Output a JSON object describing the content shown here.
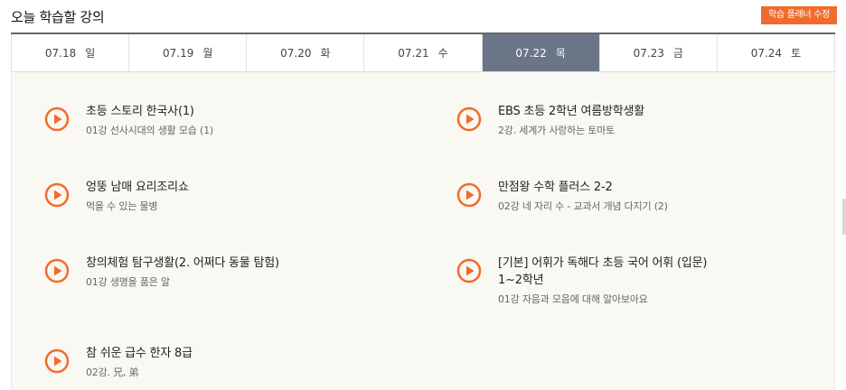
{
  "header": {
    "title": "오늘 학습할 강의",
    "edit_button": "학습 플래너 수정"
  },
  "tabs": [
    {
      "date": "07.18",
      "day": "일"
    },
    {
      "date": "07.19",
      "day": "월"
    },
    {
      "date": "07.20",
      "day": "화"
    },
    {
      "date": "07.21",
      "day": "수"
    },
    {
      "date": "07.22",
      "day": "목"
    },
    {
      "date": "07.23",
      "day": "금"
    },
    {
      "date": "07.24",
      "day": "토"
    }
  ],
  "lectures": [
    {
      "title": "초등 스토리 한국사(1)",
      "lines": [
        "01강 선사시대의 생활 모습 (1)"
      ]
    },
    {
      "title": "EBS 초등 2학년 여름방학생활",
      "lines": [
        "2강. 세계가 사랑하는 토마토"
      ]
    },
    {
      "title": "엉뚱 남매 요리조리쇼",
      "lines": [
        "먹을 수 있는 물병"
      ]
    },
    {
      "title": "만점왕 수학 플러스 2-2",
      "lines": [
        "02강 네 자리 수 - 교과서 개념 다지기 (2)"
      ]
    },
    {
      "title": "창의체험 탐구생활(2. 어쩌다 동물 탐험)",
      "lines": [
        "01강 생명을 품은 알"
      ]
    },
    {
      "title": "[기본] 어휘가 독해다 초등 국어 어휘 (입문)",
      "title2": "1~2학년",
      "lines": [
        "01강 자음과 모음에 대해 알아보아요"
      ]
    },
    {
      "title": "참 쉬운 급수 한자 8급",
      "lines": [
        "02강. 兄, 弟"
      ]
    }
  ],
  "colors": {
    "accent": "#f26b2b",
    "active_tab": "#6b7588",
    "content_bg": "#faf8f2"
  },
  "icons": {
    "play": "play-circle-icon"
  }
}
